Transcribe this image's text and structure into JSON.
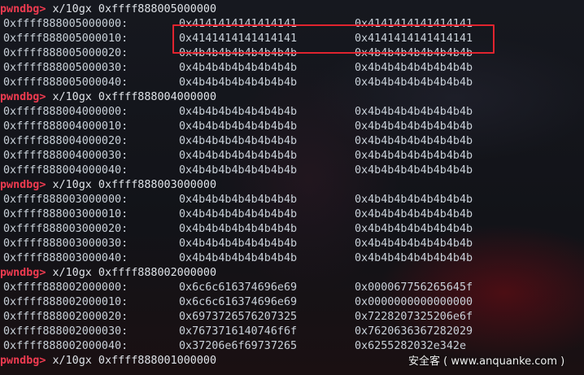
{
  "colors": {
    "prompt": "#ef3b50",
    "highlight_box": "#e0242f",
    "text": "#c9d1d9"
  },
  "blocks": [
    {
      "prompt": "pwndbg>",
      "command": "x/10gx 0xffff888005000000",
      "rows": [
        {
          "addr": "0xffff888005000000:",
          "v1": "0x4141414141414141",
          "v2": "0x4141414141414141"
        },
        {
          "addr": "0xffff888005000010:",
          "v1": "0x4141414141414141",
          "v2": "0x4141414141414141"
        },
        {
          "addr": "0xffff888005000020:",
          "v1": "0x4b4b4b4b4b4b4b4b",
          "v2": "0x4b4b4b4b4b4b4b4b"
        },
        {
          "addr": "0xffff888005000030:",
          "v1": "0x4b4b4b4b4b4b4b4b",
          "v2": "0x4b4b4b4b4b4b4b4b"
        },
        {
          "addr": "0xffff888005000040:",
          "v1": "0x4b4b4b4b4b4b4b4b",
          "v2": "0x4b4b4b4b4b4b4b4b"
        }
      ]
    },
    {
      "prompt": "pwndbg>",
      "command": "x/10gx 0xffff888004000000",
      "rows": [
        {
          "addr": "0xffff888004000000:",
          "v1": "0x4b4b4b4b4b4b4b4b",
          "v2": "0x4b4b4b4b4b4b4b4b"
        },
        {
          "addr": "0xffff888004000010:",
          "v1": "0x4b4b4b4b4b4b4b4b",
          "v2": "0x4b4b4b4b4b4b4b4b"
        },
        {
          "addr": "0xffff888004000020:",
          "v1": "0x4b4b4b4b4b4b4b4b",
          "v2": "0x4b4b4b4b4b4b4b4b"
        },
        {
          "addr": "0xffff888004000030:",
          "v1": "0x4b4b4b4b4b4b4b4b",
          "v2": "0x4b4b4b4b4b4b4b4b"
        },
        {
          "addr": "0xffff888004000040:",
          "v1": "0x4b4b4b4b4b4b4b4b",
          "v2": "0x4b4b4b4b4b4b4b4b"
        }
      ]
    },
    {
      "prompt": "pwndbg>",
      "command": "x/10gx 0xffff888003000000",
      "rows": [
        {
          "addr": "0xffff888003000000:",
          "v1": "0x4b4b4b4b4b4b4b4b",
          "v2": "0x4b4b4b4b4b4b4b4b"
        },
        {
          "addr": "0xffff888003000010:",
          "v1": "0x4b4b4b4b4b4b4b4b",
          "v2": "0x4b4b4b4b4b4b4b4b"
        },
        {
          "addr": "0xffff888003000020:",
          "v1": "0x4b4b4b4b4b4b4b4b",
          "v2": "0x4b4b4b4b4b4b4b4b"
        },
        {
          "addr": "0xffff888003000030:",
          "v1": "0x4b4b4b4b4b4b4b4b",
          "v2": "0x4b4b4b4b4b4b4b4b"
        },
        {
          "addr": "0xffff888003000040:",
          "v1": "0x4b4b4b4b4b4b4b4b",
          "v2": "0x4b4b4b4b4b4b4b4b"
        }
      ]
    },
    {
      "prompt": "pwndbg>",
      "command": "x/10gx 0xffff888002000000",
      "rows": [
        {
          "addr": "0xffff888002000000:",
          "v1": "0x6c6c616374696e69",
          "v2": "0x000067756265645f"
        },
        {
          "addr": "0xffff888002000010:",
          "v1": "0x6c6c616374696e69",
          "v2": "0x0000000000000000"
        },
        {
          "addr": "0xffff888002000020:",
          "v1": "0x6973726576207325",
          "v2": "0x7228207325206e6f"
        },
        {
          "addr": "0xffff888002000030:",
          "v1": "0x7673716140746f6f",
          "v2": "0x7620636367282029"
        },
        {
          "addr": "0xffff888002000040:",
          "v1": "0x37206e6f69737265",
          "v2": "0x6255282032e342e"
        }
      ]
    },
    {
      "prompt": "pwndbg>",
      "command": "x/10gx 0xffff888001000000",
      "rows": []
    }
  ],
  "watermark": "安全客 ( www.anquanke.com )"
}
